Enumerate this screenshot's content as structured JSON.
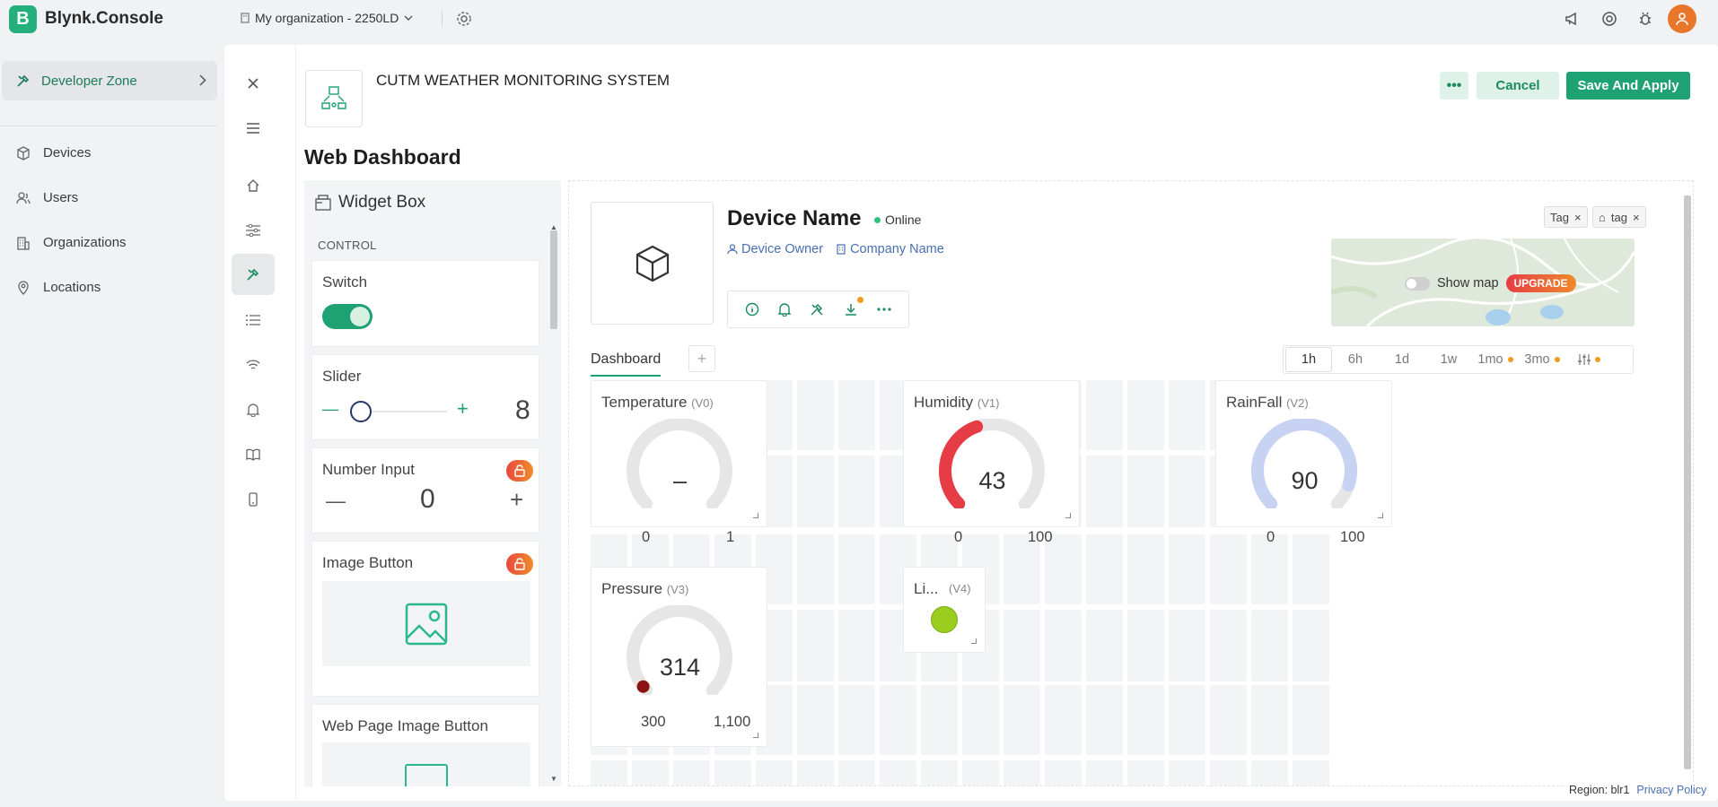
{
  "app": {
    "logo_letter": "B",
    "name": "Blynk.Console"
  },
  "topbar": {
    "organization": "My organization - 2250LD"
  },
  "nav": {
    "developer_zone": "Developer Zone",
    "items": [
      {
        "label": "Devices",
        "icon": "cube-icon"
      },
      {
        "label": "Users",
        "icon": "users-icon"
      },
      {
        "label": "Organizations",
        "icon": "building-icon"
      },
      {
        "label": "Locations",
        "icon": "pin-icon"
      }
    ]
  },
  "header": {
    "template_title": "CUTM WEATHER MONITORING SYSTEM",
    "more_label": "•••",
    "cancel_label": "Cancel",
    "save_label": "Save And Apply",
    "page_title": "Web Dashboard"
  },
  "widget_box": {
    "title": "Widget Box",
    "section": "CONTROL",
    "widgets": [
      {
        "label": "Switch"
      },
      {
        "label": "Slider",
        "minus": "—",
        "plus": "+",
        "value": "8"
      },
      {
        "label": "Number Input",
        "minus": "—",
        "value": "0",
        "plus": "+"
      },
      {
        "label": "Image Button"
      },
      {
        "label": "Web Page Image Button"
      }
    ]
  },
  "device": {
    "name": "Device Name",
    "status": "Online",
    "owner": "Device Owner",
    "company": "Company Name",
    "tags": [
      "Tag",
      "tag"
    ],
    "show_map": "Show map",
    "upgrade": "UPGRADE"
  },
  "tabs": {
    "dashboard": "Dashboard",
    "add": "+"
  },
  "ranges": [
    "1h",
    "6h",
    "1d",
    "1w",
    "1mo",
    "3mo"
  ],
  "gauges": [
    {
      "title": "Temperature",
      "pin": "(V0)",
      "value": "–",
      "min": "0",
      "max": "1",
      "fraction": 0,
      "color": "#e5e5e5"
    },
    {
      "title": "Humidity",
      "pin": "(V1)",
      "value": "43",
      "min": "0",
      "max": "100",
      "fraction": 0.43,
      "color": "#e63c45"
    },
    {
      "title": "RainFall",
      "pin": "(V2)",
      "value": "90",
      "min": "0",
      "max": "100",
      "fraction": 0.9,
      "color": "#c8d2f2"
    },
    {
      "title": "Pressure",
      "pin": "(V3)",
      "value": "314",
      "min": "300",
      "max": "1,100",
      "fraction": 0.0175,
      "color": "#8b1212"
    }
  ],
  "led": {
    "title": "Li...",
    "pin": "(V4)",
    "color": "#9acd1e"
  },
  "footer": {
    "region": "Region: blr1",
    "privacy": "Privacy Policy"
  },
  "colors": {
    "brand": "#23b07d",
    "primary_button": "#1ea273",
    "link": "#4a6fb0"
  }
}
